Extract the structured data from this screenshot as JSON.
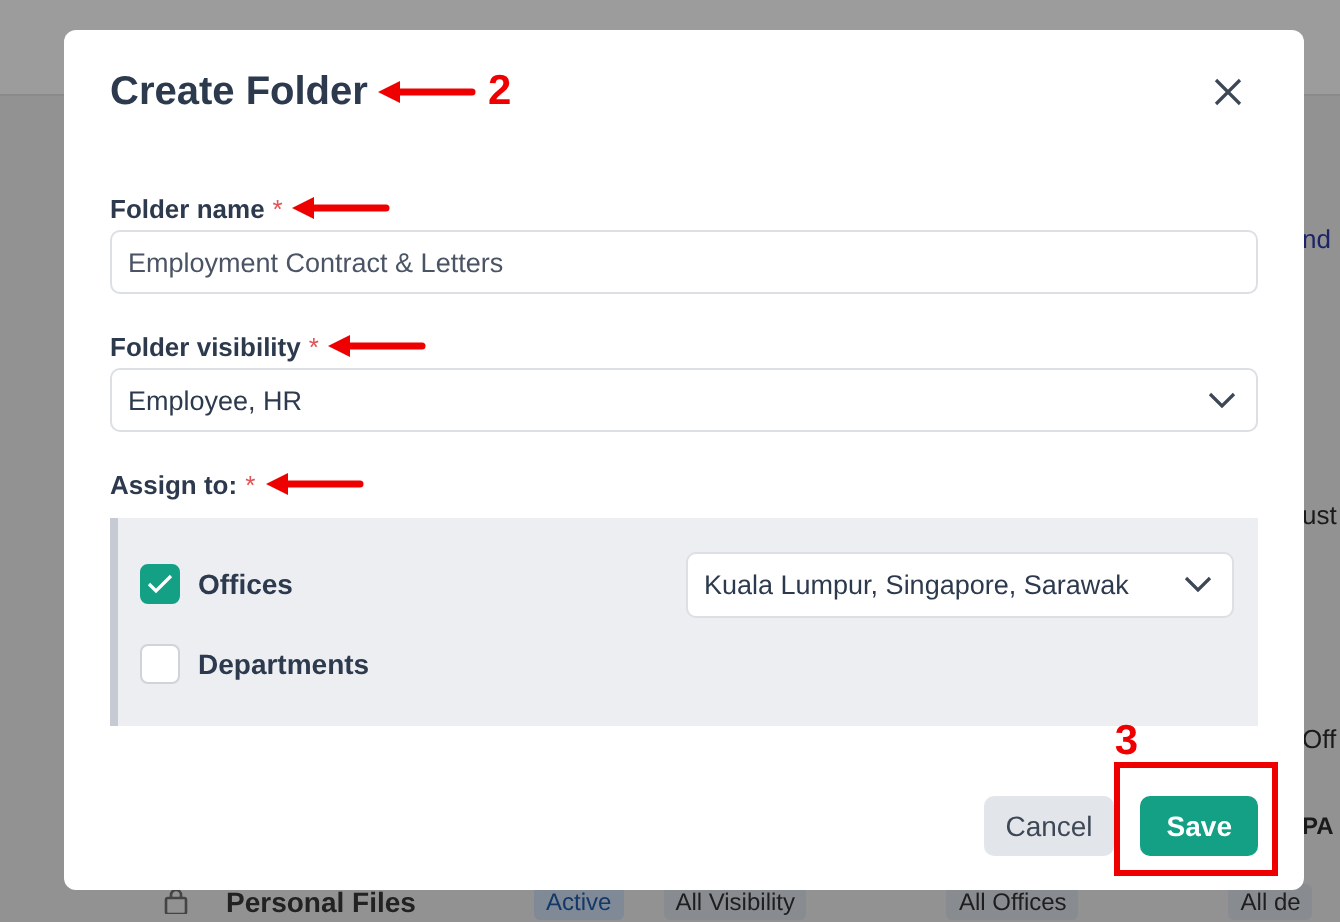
{
  "background": {
    "fragments": [
      {
        "text": "nd",
        "kind": "link"
      },
      {
        "text": "ust",
        "kind": "tab"
      },
      {
        "text": "Off",
        "kind": "cell"
      },
      {
        "text": "PA",
        "kind": "cell"
      }
    ],
    "row": {
      "name": "Personal Files",
      "status": "Active",
      "visibility": "All Visibility",
      "offices": "All Offices",
      "departments": "All de"
    }
  },
  "dialog": {
    "title": "Create Folder",
    "fields": [
      {
        "label": "Folder name",
        "required_mark": "*",
        "kind": "text",
        "value": "Employment Contract & Letters"
      },
      {
        "label": "Folder visibility",
        "required_mark": "*",
        "kind": "select",
        "value": "Employee, HR"
      }
    ],
    "assign": {
      "label": "Assign to:",
      "required_mark": "*",
      "options": [
        {
          "label": "Offices",
          "checked": true,
          "value": "Kuala Lumpur, Singapore, Sarawak"
        },
        {
          "label": "Departments",
          "checked": false
        }
      ]
    },
    "buttons": [
      {
        "label": "Cancel",
        "kind": "secondary"
      },
      {
        "label": "Save",
        "kind": "primary"
      }
    ]
  },
  "annotations": [
    {
      "text": "2"
    },
    {
      "text": "3"
    }
  ]
}
